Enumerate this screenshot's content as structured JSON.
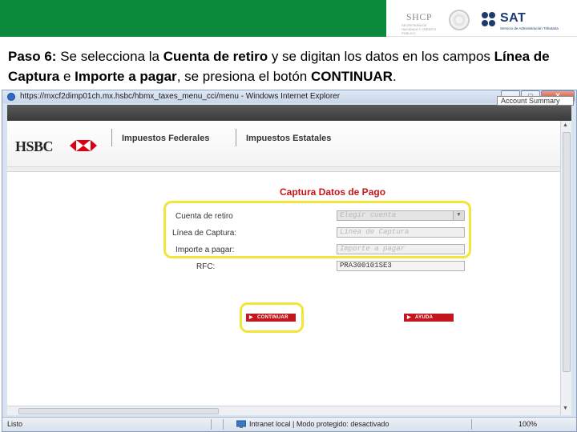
{
  "banner": {
    "shcp_text": "SHCP",
    "shcp_sub": "SECRETARÍA DE HACIENDA Y CRÉDITO PÚBLICO",
    "sat_text": "SAT",
    "sat_sub": "Servicio de Administración Tributaria",
    "green": "#0a8a3a"
  },
  "instruction": {
    "step": "Paso 6:",
    "t1": " Se selecciona la ",
    "b1": "Cuenta de retiro",
    "t2": " y se digitan los datos en los campos ",
    "b2": "Línea de Captura",
    "t3": " e ",
    "b3": "Importe a pagar",
    "t4": ", se presiona el botón ",
    "b4": "CONTINUAR",
    "t5": "."
  },
  "browser": {
    "title": "https://mxcf2dimp01ch.mx.hsbc/hbmx_taxes_menu_cci/menu - Windows Internet Explorer",
    "close_label": "X",
    "status_ready": "Listo",
    "status_zone": "Intranet local | Modo protegido: desactivado",
    "zoom": "100%"
  },
  "hsbc": {
    "logo": "HSBC",
    "nav_federal": "Impuestos Federales",
    "nav_estatal": "Impuestos Estatales"
  },
  "form": {
    "title": "Captura Datos de Pago",
    "cuenta_label": "Cuenta de retiro",
    "cuenta_placeholder": "Elegir cuenta",
    "linea_label": "Línea de Captura:",
    "linea_placeholder": "Linea de Captura",
    "importe_label": "Importe a pagar:",
    "importe_placeholder": "Importe a pagar",
    "rfc_label": "RFC:",
    "rfc_value": "PRA300101SE3",
    "continuar": "CONTINUAR",
    "ayuda": "AYUDA",
    "accent": "#c4161c",
    "highlight": "#f2e53a"
  },
  "tooltip": {
    "account_summary": "Account Summary"
  }
}
